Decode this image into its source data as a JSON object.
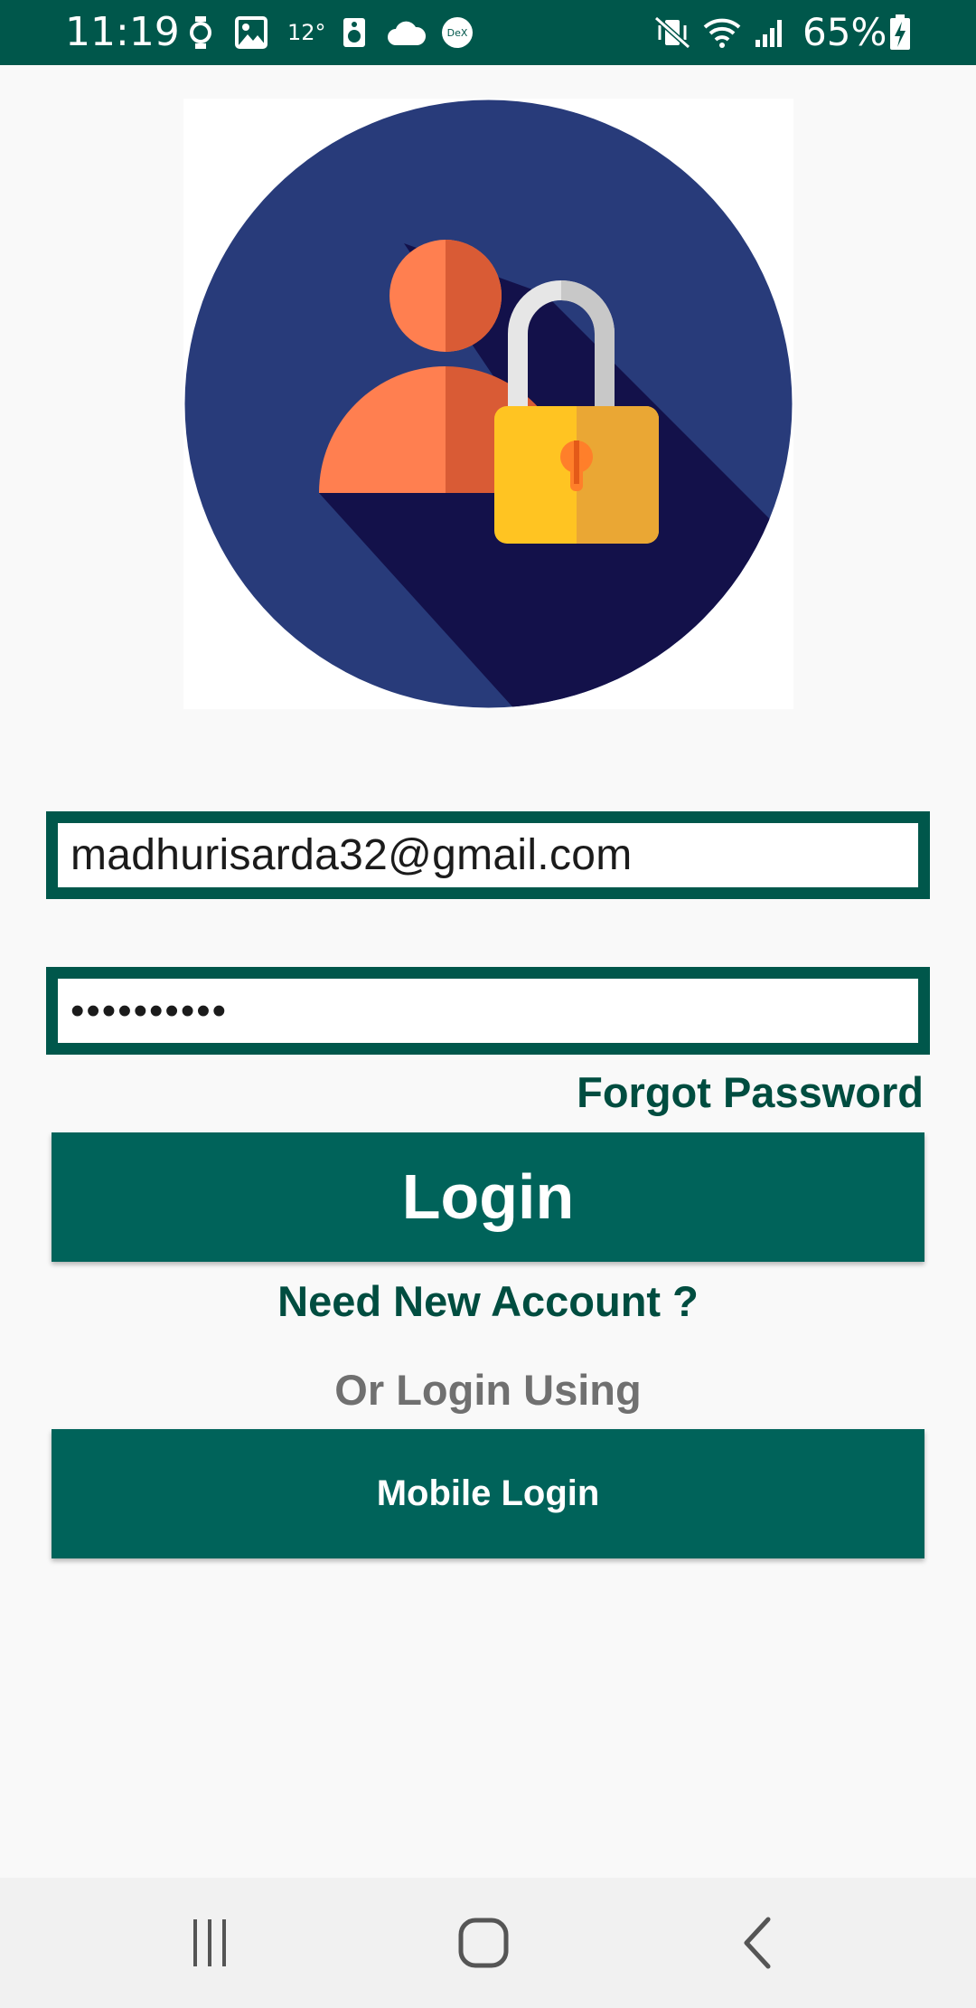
{
  "status_bar": {
    "time": "11:19",
    "temperature": "12°",
    "battery": "65%",
    "icons": [
      "watch-icon",
      "image-icon",
      "speaker-icon",
      "cloud-icon",
      "dex-icon",
      "mute-vibrate-icon",
      "wifi-icon",
      "signal-icon",
      "battery-charging-icon"
    ],
    "dex_label": "DeX",
    "background_color": "#00574b"
  },
  "logo": {
    "icon": "user-lock-icon",
    "colors": {
      "circle": "#283b7a",
      "shadow": "#13114a",
      "user": "#ff7f50",
      "padlock": "#ffc422"
    }
  },
  "form": {
    "email_value": "madhurisarda32@gmail.com",
    "password_value": "••••••••••",
    "forgot_password_label": "Forgot Password",
    "login_label": "Login",
    "new_account_label": "Need New Account ?",
    "or_login_label": "Or Login Using",
    "mobile_login_label": "Mobile Login"
  },
  "theme": {
    "primary": "#00635a",
    "primary_dark": "#00574b",
    "link": "#004d40",
    "muted": "#707070"
  },
  "nav_bar": {
    "buttons": [
      "recent-apps-icon",
      "home-icon",
      "back-icon"
    ]
  }
}
